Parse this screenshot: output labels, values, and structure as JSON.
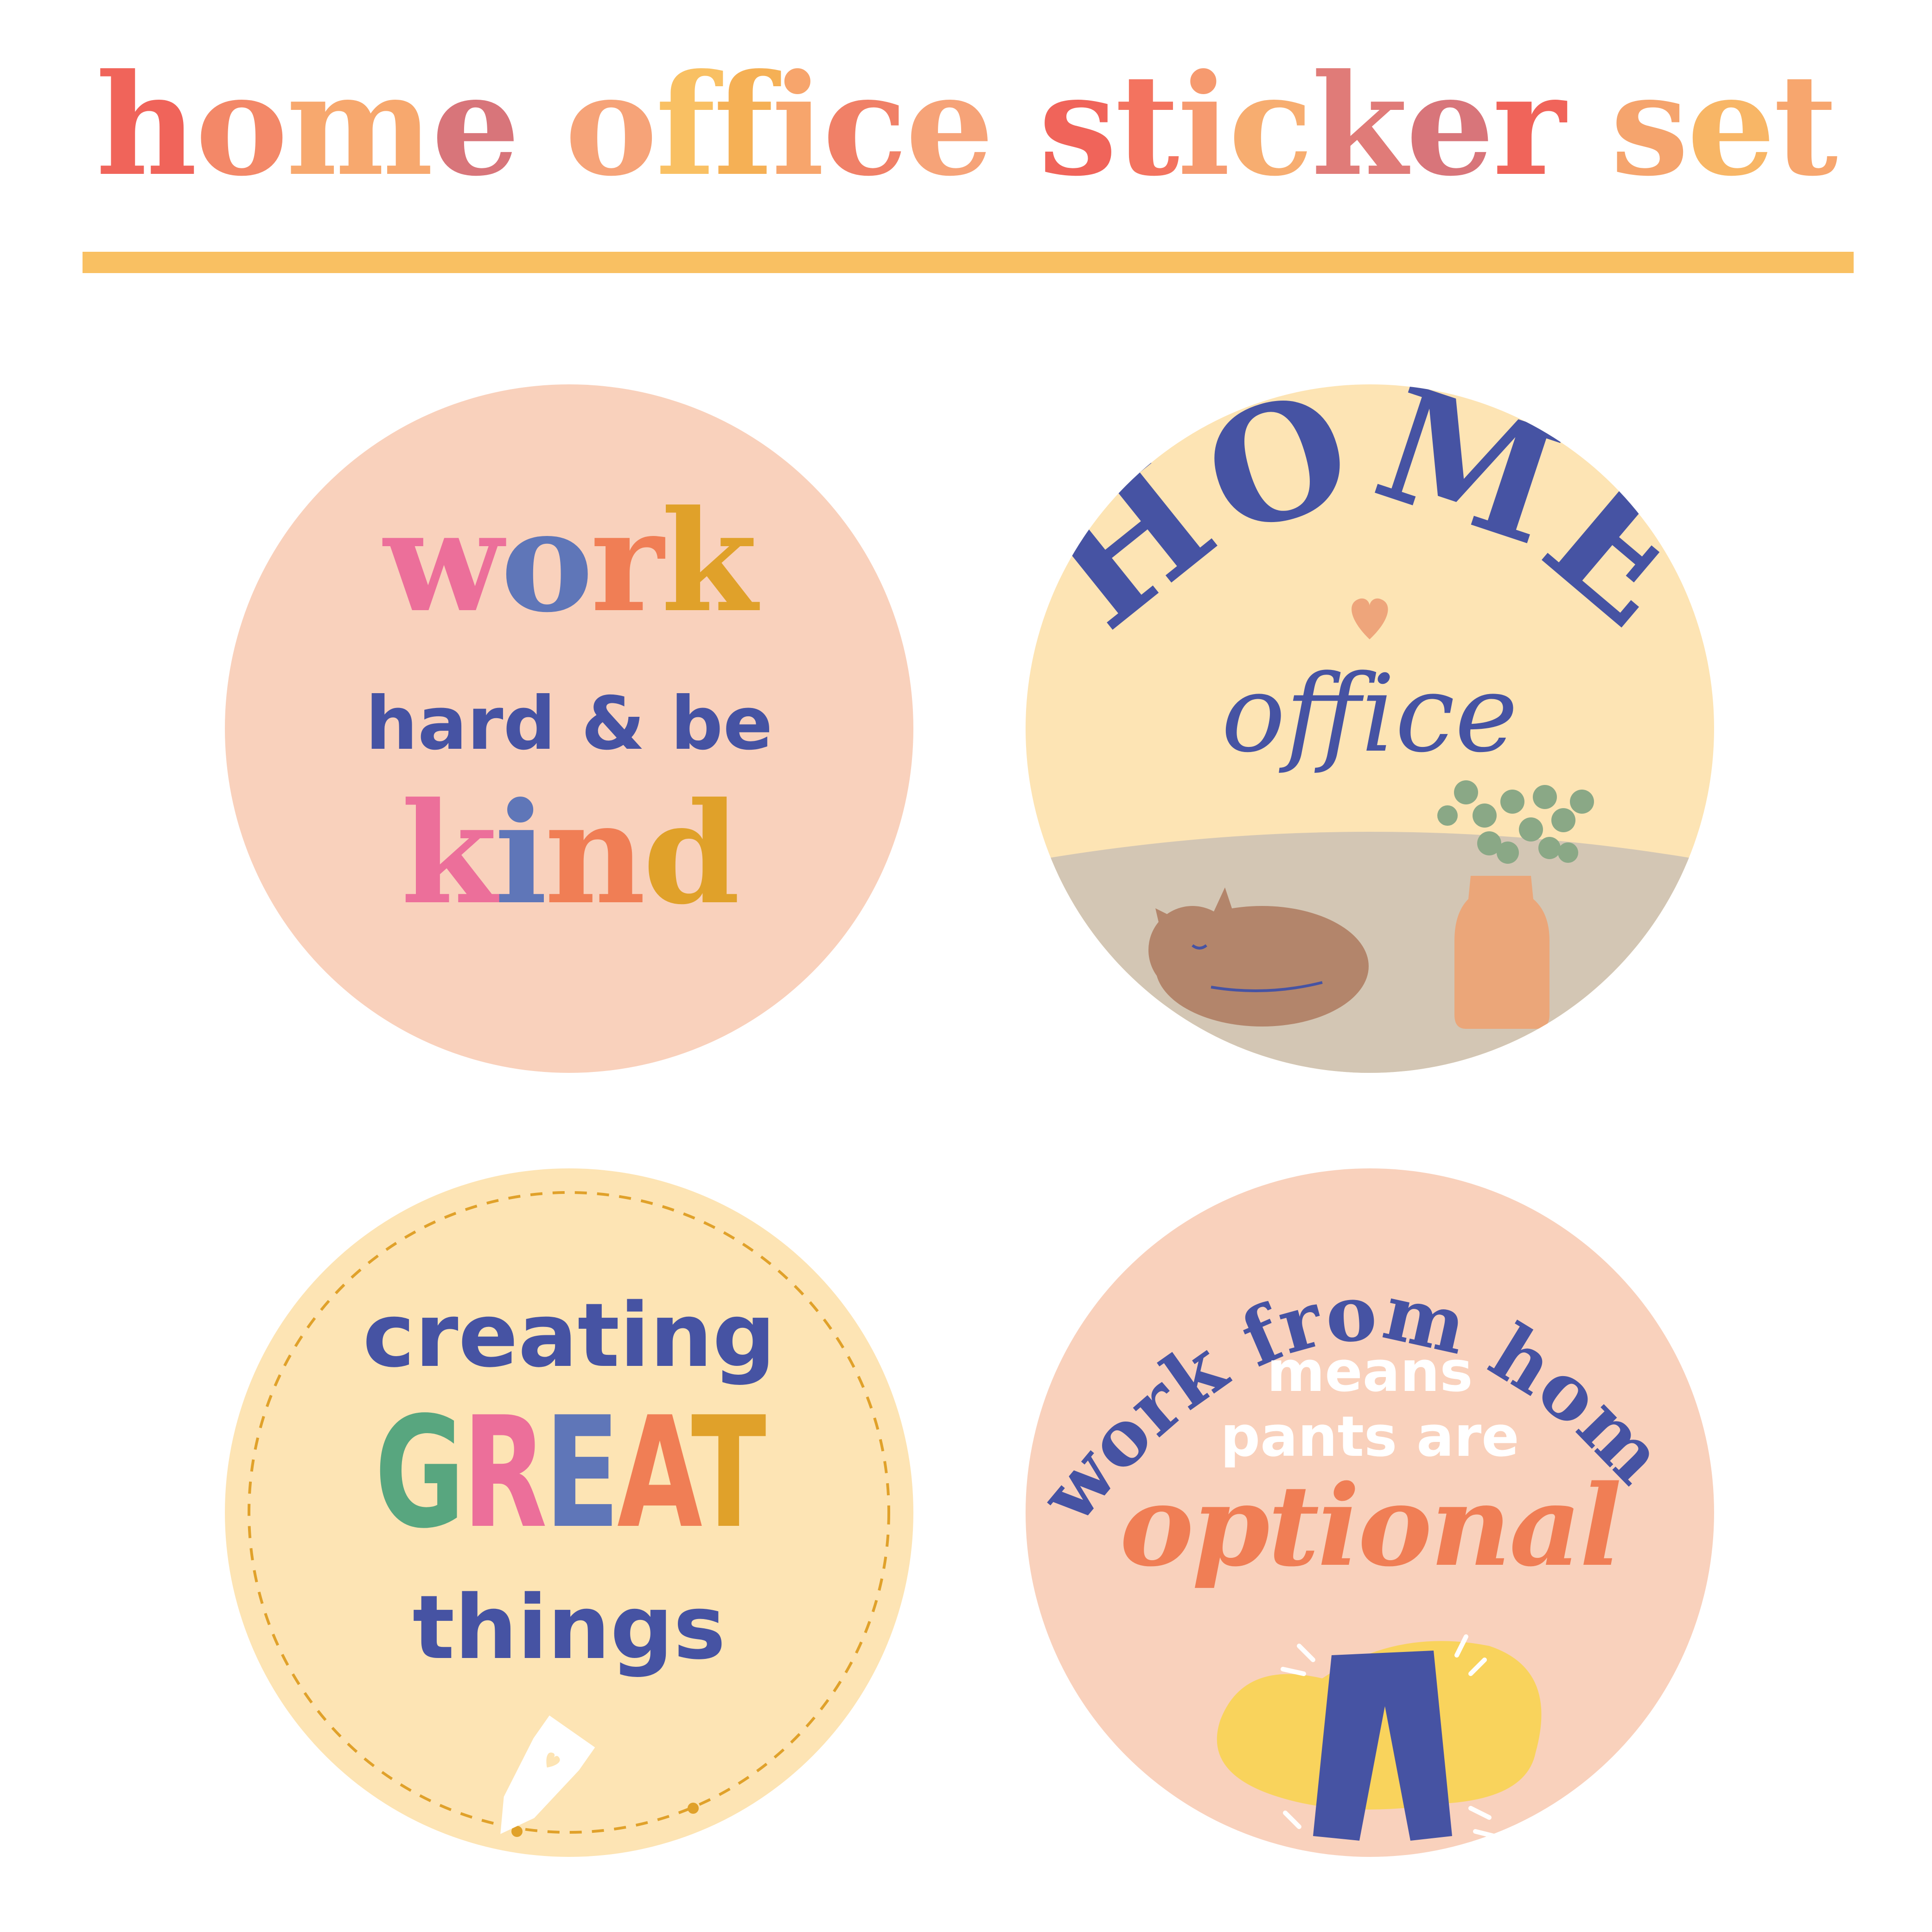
{
  "title": {
    "words": [
      {
        "text": "home",
        "colors": [
          "#f0645a",
          "#f38868",
          "#f7a86e",
          "#d8757a"
        ]
      },
      {
        "text": "office",
        "colors": [
          "#f6a378",
          "#f9c063",
          "#f5b055",
          "#f7a56c",
          "#f08067",
          "#f6a378"
        ]
      },
      {
        "text": "sticker",
        "colors": [
          "#f0645a",
          "#f3735f",
          "#f69a6f",
          "#f7ad70",
          "#e07b78",
          "#d8757a",
          "#f0645a"
        ]
      },
      {
        "text": "set",
        "colors": [
          "#f5a46d",
          "#f8b666",
          "#f7a66e"
        ]
      }
    ]
  },
  "colors": {
    "rule": "#f9c062",
    "peach": "#f9d1bc",
    "cream": "#fde4b4",
    "navy": "#4653a3",
    "floor": "#d3c6b4",
    "pink": "#ec6f9a",
    "blue": "#5f76b8",
    "orange": "#f07e55",
    "mustard": "#e0a12a",
    "green": "#58a67f"
  },
  "stickers": {
    "work_hard": {
      "word1": {
        "letters": [
          [
            "w",
            "#ec6f9a"
          ],
          [
            "o",
            "#5f76b8"
          ],
          [
            "r",
            "#f07e55"
          ],
          [
            "k",
            "#e0a12a"
          ]
        ]
      },
      "middle": "hard & be",
      "word2": {
        "letters": [
          [
            "k",
            "#ec6f9a"
          ],
          [
            "i",
            "#5f76b8"
          ],
          [
            "n",
            "#f07e55"
          ],
          [
            "d",
            "#e0a12a"
          ]
        ]
      }
    },
    "home_office": {
      "top": "HOME",
      "script": "office"
    },
    "creating": {
      "line1": "creating",
      "great": {
        "letters": [
          [
            "G",
            "#58a67f"
          ],
          [
            "R",
            "#ec6f9a"
          ],
          [
            "E",
            "#5f76b8"
          ],
          [
            "A",
            "#f07e55"
          ],
          [
            "T",
            "#e0a12a"
          ]
        ]
      },
      "line3": "things"
    },
    "wfh": {
      "arc": "work from home",
      "line2": "means",
      "line3": "pants are",
      "line4": "optional"
    }
  }
}
